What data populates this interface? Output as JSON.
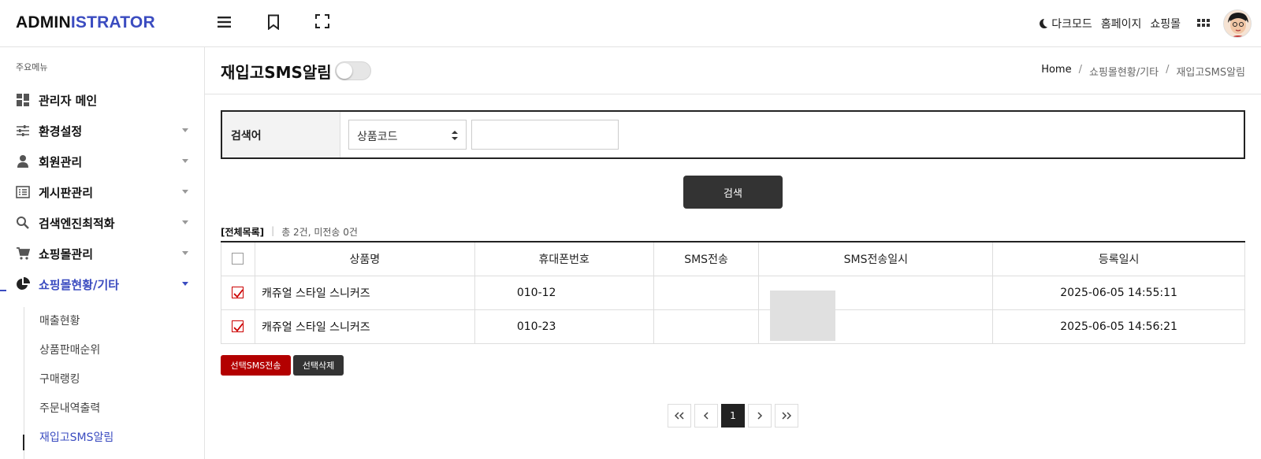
{
  "header": {
    "logo_part1": "ADMIN",
    "logo_part2": "ISTRATOR",
    "links": {
      "dark_mode": "다크모드",
      "homepage": "홈페이지",
      "shop": "쇼핑몰"
    }
  },
  "sidebar": {
    "caption": "주요메뉴",
    "items": [
      {
        "label": "관리자 메인",
        "icon": "dashboard-icon"
      },
      {
        "label": "환경설정",
        "icon": "sliders-icon"
      },
      {
        "label": "회원관리",
        "icon": "person-icon"
      },
      {
        "label": "게시판관리",
        "icon": "list-icon"
      },
      {
        "label": "검색엔진최적화",
        "icon": "search-icon"
      },
      {
        "label": "쇼핑몰관리",
        "icon": "cart-icon"
      },
      {
        "label": "쇼핑몰현황/기타",
        "icon": "pie-chart-icon"
      }
    ],
    "subitems": [
      "매출현황",
      "상품판매순위",
      "구매랭킹",
      "주문내역출력",
      "재입고SMS알림"
    ]
  },
  "page": {
    "title": "재입고SMS알림",
    "breadcrumb": {
      "home": "Home",
      "parent": "쇼핑몰현황/기타",
      "current": "재입고SMS알림"
    },
    "breadcrumb_sep": "/"
  },
  "search": {
    "label": "검색어",
    "select_value": "상품코드",
    "input_value": "",
    "button": "검색"
  },
  "list": {
    "all_label": "[전체목록]",
    "summary": "총 2건, 미전송 0건",
    "columns": [
      "상품명",
      "휴대폰번호",
      "SMS전송",
      "SMS전송일시",
      "등록일시"
    ],
    "rows": [
      {
        "checked": true,
        "product": "캐쥬얼 스타일 스니커즈",
        "phone": "010-12",
        "sms": "",
        "sms_date": "",
        "reg_date": "2025-06-05 14:55:11"
      },
      {
        "checked": true,
        "product": "캐쥬얼 스타일 스니커즈",
        "phone": "010-23",
        "sms": "",
        "sms_date": "",
        "reg_date": "2025-06-05 14:56:21"
      }
    ]
  },
  "actions": {
    "send_sms": "선택SMS전송",
    "delete": "선택삭제"
  },
  "pagination": {
    "current": "1"
  },
  "colors": {
    "accent": "#3b4cc0",
    "danger": "#b30000",
    "dark": "#333333"
  }
}
